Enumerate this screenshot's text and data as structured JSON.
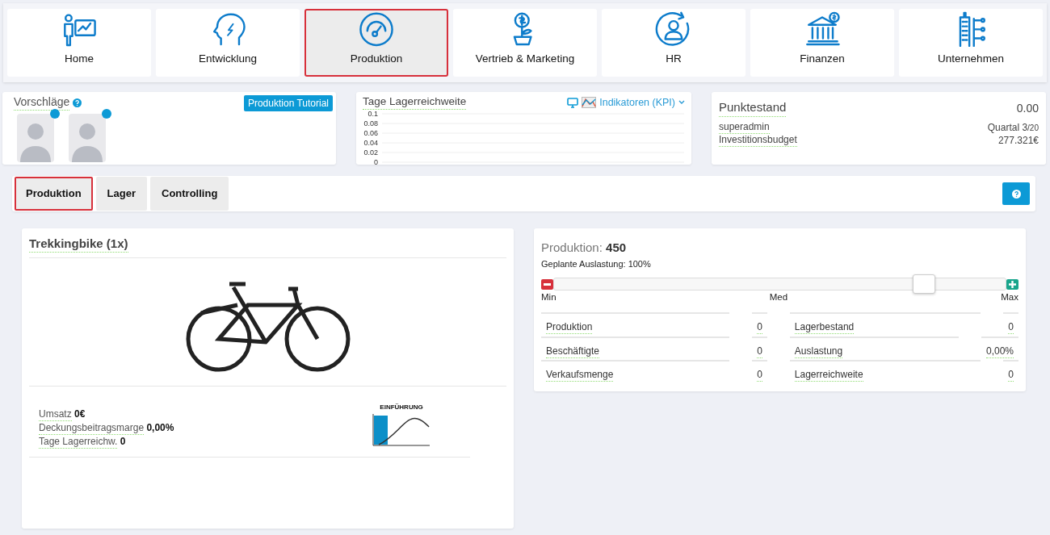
{
  "nav": [
    {
      "label": "Home",
      "kind": "presenter",
      "selected": false
    },
    {
      "label": "Entwicklung",
      "kind": "head",
      "selected": false
    },
    {
      "label": "Produktion",
      "kind": "gauge",
      "selected": true
    },
    {
      "label": "Vertrieb & Marketing",
      "kind": "plant",
      "selected": false
    },
    {
      "label": "HR",
      "kind": "person",
      "selected": false
    },
    {
      "label": "Finanzen",
      "kind": "bank",
      "selected": false
    },
    {
      "label": "Unternehmen",
      "kind": "building",
      "selected": false
    }
  ],
  "suggestions": {
    "title": "Vorschläge",
    "tutorial_button": "Produktion Tutorial",
    "candidates": [
      {
        "kind": "photo"
      },
      {
        "kind": "photo"
      }
    ]
  },
  "kpi_card": {
    "title": "Tage Lagerreichweite",
    "dropdown": "Indikatoren (KPI)",
    "axis_labels": [
      "0.1",
      "0.08",
      "0.06",
      "0.04",
      "0.02",
      "0"
    ]
  },
  "score": {
    "title": "Punktestand",
    "value": "0.00",
    "rows": [
      {
        "label": "superadmin",
        "value": "Quartal 3",
        "value_small": "/20"
      },
      {
        "label": "Investitionsbudget",
        "value": "277.321€"
      }
    ]
  },
  "tabs": [
    {
      "label": "Produktion",
      "selected": true
    },
    {
      "label": "Lager",
      "selected": false
    },
    {
      "label": "Controlling",
      "selected": false
    }
  ],
  "product": {
    "title": "Trekkingbike (1x)",
    "stats": [
      {
        "label": "Umsatz",
        "value": "0€"
      },
      {
        "label": "Deckungsbeitragsmarge",
        "value": "0,00%"
      },
      {
        "label": "Tage Lagerreichw.",
        "value": "0"
      }
    ],
    "lifecycle_label": "EINFÜHRUNG"
  },
  "production": {
    "label": "Produktion:",
    "value": "450",
    "planned": "Geplante Auslastung: 100%",
    "slider": {
      "level": 0.82,
      "min_label": "Min",
      "mid_label": "Med",
      "max_label": "Max"
    },
    "left_metrics": [
      {
        "label": "Produktion",
        "value": "0"
      },
      {
        "label": "Beschäftigte",
        "value": "0"
      },
      {
        "label": "Verkaufsmenge",
        "value": "0"
      }
    ],
    "right_metrics": [
      {
        "label": "Lagerbestand",
        "value": "0"
      },
      {
        "label": "Auslastung",
        "value": "0,00%"
      },
      {
        "label": "Lagerreichweite",
        "value": "0"
      }
    ]
  }
}
